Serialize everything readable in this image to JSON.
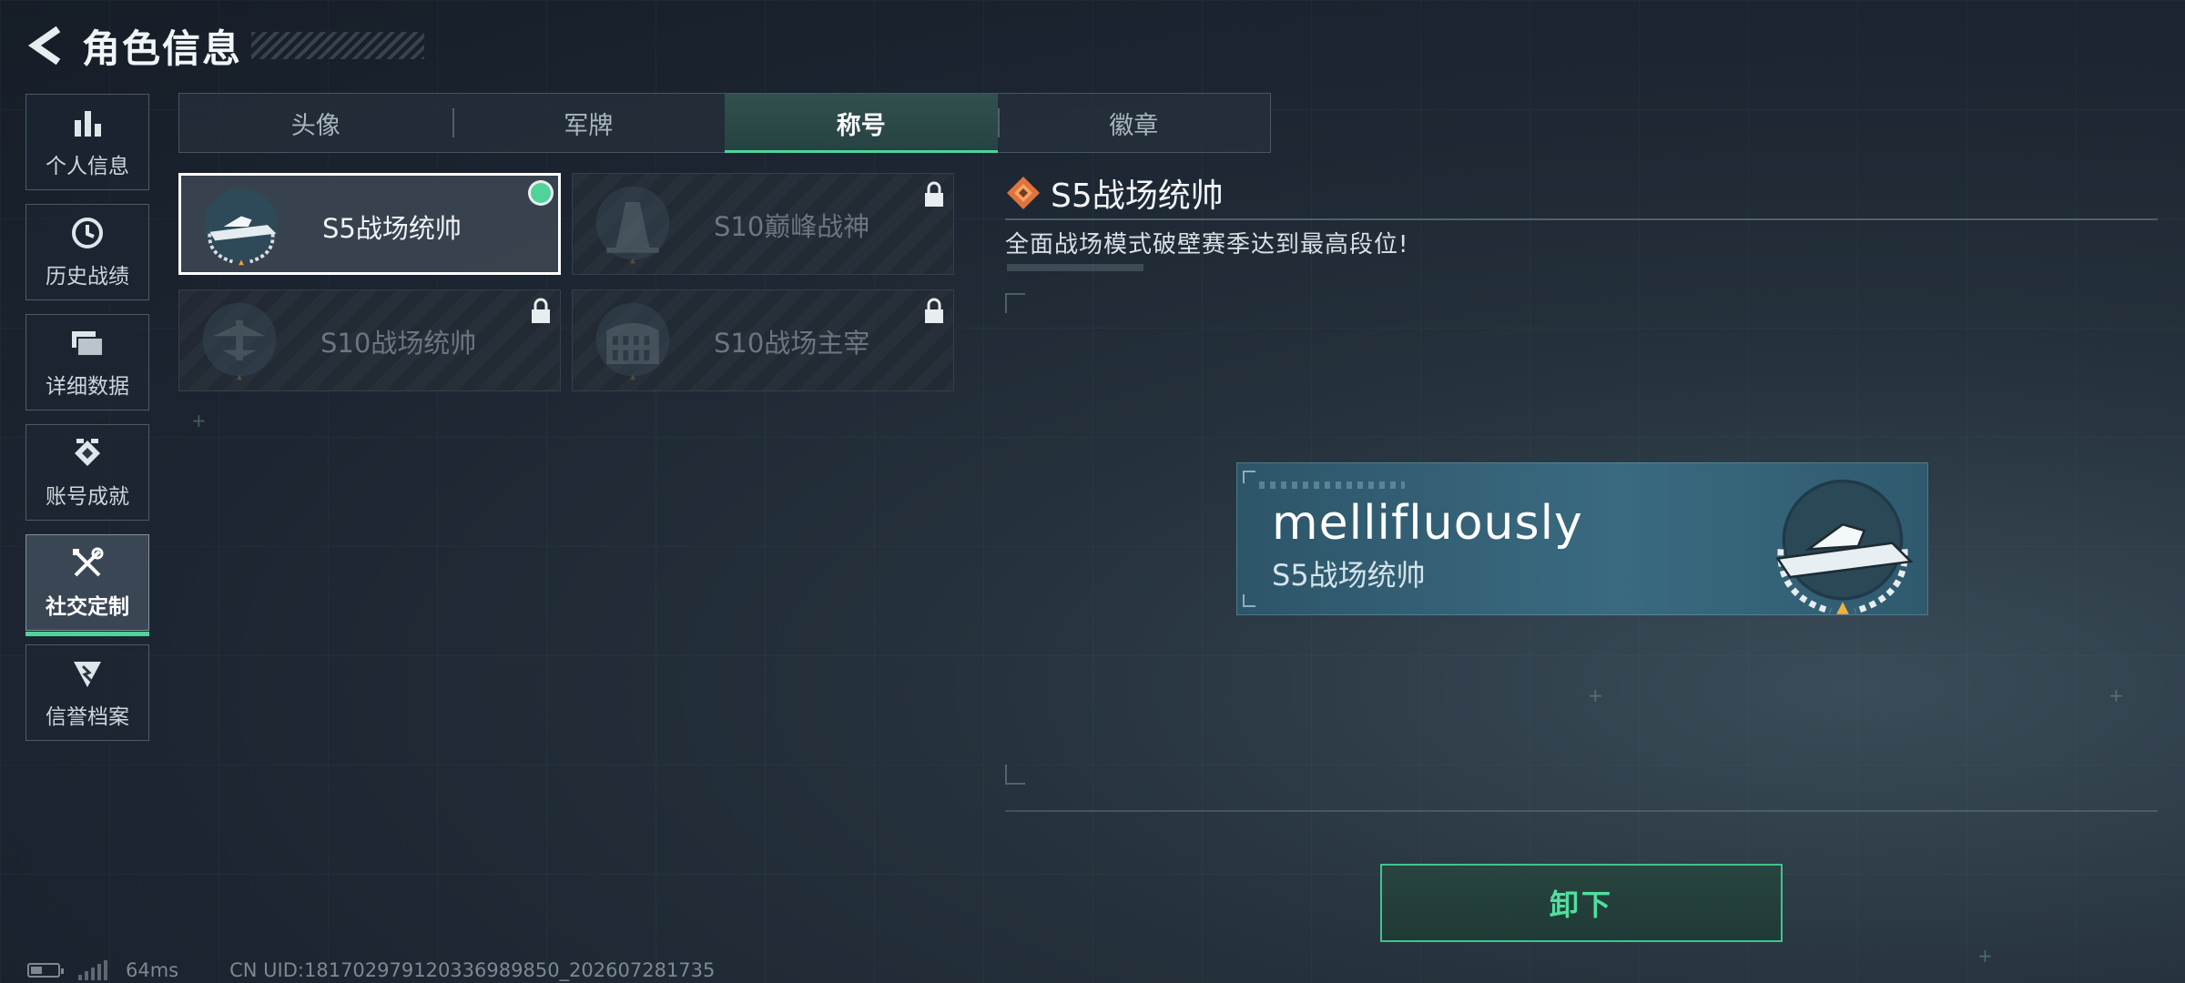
{
  "header": {
    "title": "角色信息"
  },
  "nav": {
    "items": [
      {
        "label": "个人信息",
        "icon": "bar-chart-icon"
      },
      {
        "label": "历史战绩",
        "icon": "clock-icon"
      },
      {
        "label": "详细数据",
        "icon": "folders-icon"
      },
      {
        "label": "账号成就",
        "icon": "achievement-icon"
      },
      {
        "label": "社交定制",
        "icon": "tools-icon",
        "active": true
      },
      {
        "label": "信誉档案",
        "icon": "credit-shield-icon"
      }
    ]
  },
  "tabs": [
    {
      "label": "头像"
    },
    {
      "label": "军牌"
    },
    {
      "label": "称号",
      "active": true
    },
    {
      "label": "徽章"
    }
  ],
  "titles": [
    {
      "name": "S5战场统帅",
      "selected": true,
      "equipped": true,
      "locked": false,
      "badge": "speedboat-badge"
    },
    {
      "name": "S10巅峰战神",
      "selected": false,
      "equipped": false,
      "locked": true,
      "badge": "tower-badge"
    },
    {
      "name": "S10战场统帅",
      "selected": false,
      "equipped": false,
      "locked": true,
      "badge": "aircraft-badge"
    },
    {
      "name": "S10战场主宰",
      "selected": false,
      "equipped": false,
      "locked": true,
      "badge": "colosseum-badge"
    }
  ],
  "detail": {
    "title": "S5战场统帅",
    "description": "全面战场模式破壁赛季达到最高段位!"
  },
  "preview": {
    "username": "mellifluously",
    "title": "S5战场统帅"
  },
  "actions": {
    "unequip_label": "卸下"
  },
  "status": {
    "ping": "64ms",
    "uid": "CN UID:1817029791203369898​50_202607281735"
  },
  "colors": {
    "accent": "#4fd39a",
    "accent_text": "#4fe0a0",
    "background": "#1b2430"
  }
}
